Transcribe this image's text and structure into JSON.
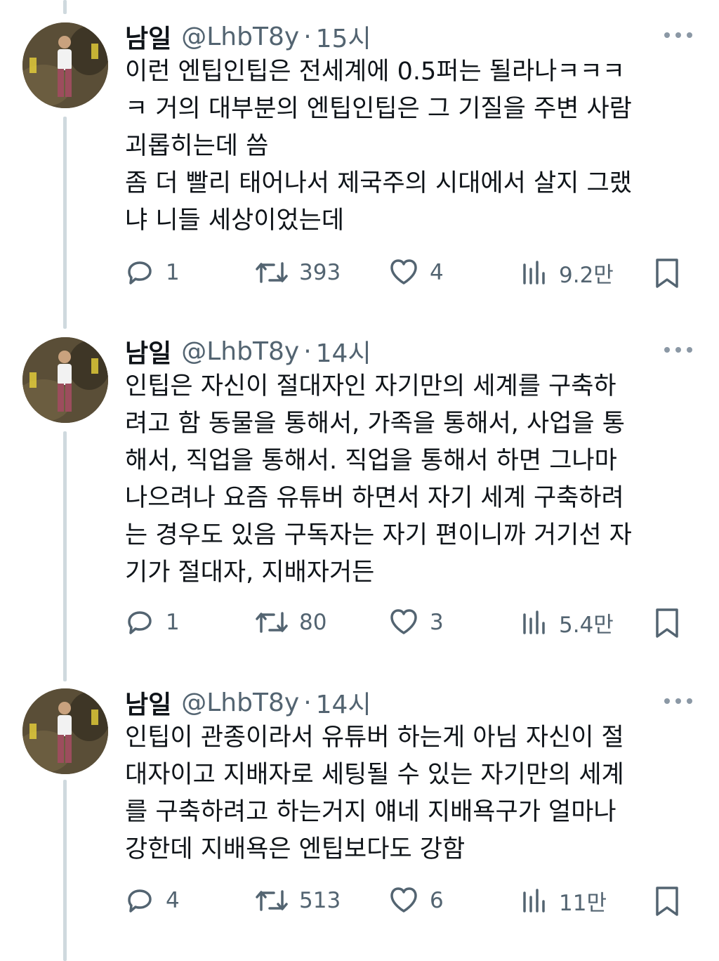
{
  "tweets": [
    {
      "display_name": "남일",
      "handle": "@LhbT8y",
      "separator": "·",
      "time": "15시",
      "text": "이런 엔팁인팁은 전세계에 0.5퍼는 될라나ㅋㅋㅋ\nㅋ 거의 대부분의 엔팁인팁은 그 기질을 주변 사람\n괴롭히는데 씀\n좀 더 빨리 태어나서 제국주의 시대에서 살지 그랬\n냐 니들 세상이었는데",
      "replies": "1",
      "retweets": "393",
      "likes": "4",
      "views": "9.2만"
    },
    {
      "display_name": "남일",
      "handle": "@LhbT8y",
      "separator": "·",
      "time": "14시",
      "text": "인팁은 자신이 절대자인 자기만의 세계를 구축하\n려고 함 동물을 통해서, 가족을 통해서, 사업을 통\n해서, 직업을 통해서. 직업을 통해서 하면 그나마\n나으려나 요즘 유튜버 하면서 자기 세계 구축하려\n는 경우도 있음 구독자는 자기 편이니까 거기선 자\n기가 절대자, 지배자거든",
      "replies": "1",
      "retweets": "80",
      "likes": "3",
      "views": "5.4만"
    },
    {
      "display_name": "남일",
      "handle": "@LhbT8y",
      "separator": "·",
      "time": "14시",
      "text": "인팁이 관종이라서 유튜버 하는게 아님 자신이 절\n대자이고 지배자로 세팅될 수 있는 자기만의 세계\n를 구축하려고 하는거지 얘네 지배욕구가 얼마나\n강한데 지배욕은 엔팁보다도 강함",
      "replies": "4",
      "retweets": "513",
      "likes": "6",
      "views": "11만"
    }
  ],
  "icons": {
    "reply": "reply-icon",
    "retweet": "retweet-icon",
    "like": "heart-icon",
    "views": "views-chart-icon",
    "bookmark": "bookmark-icon",
    "more": "more-dots-icon"
  },
  "colors": {
    "text": "#0f1419",
    "secondary": "#536471",
    "thread_line": "#cfd9de"
  }
}
